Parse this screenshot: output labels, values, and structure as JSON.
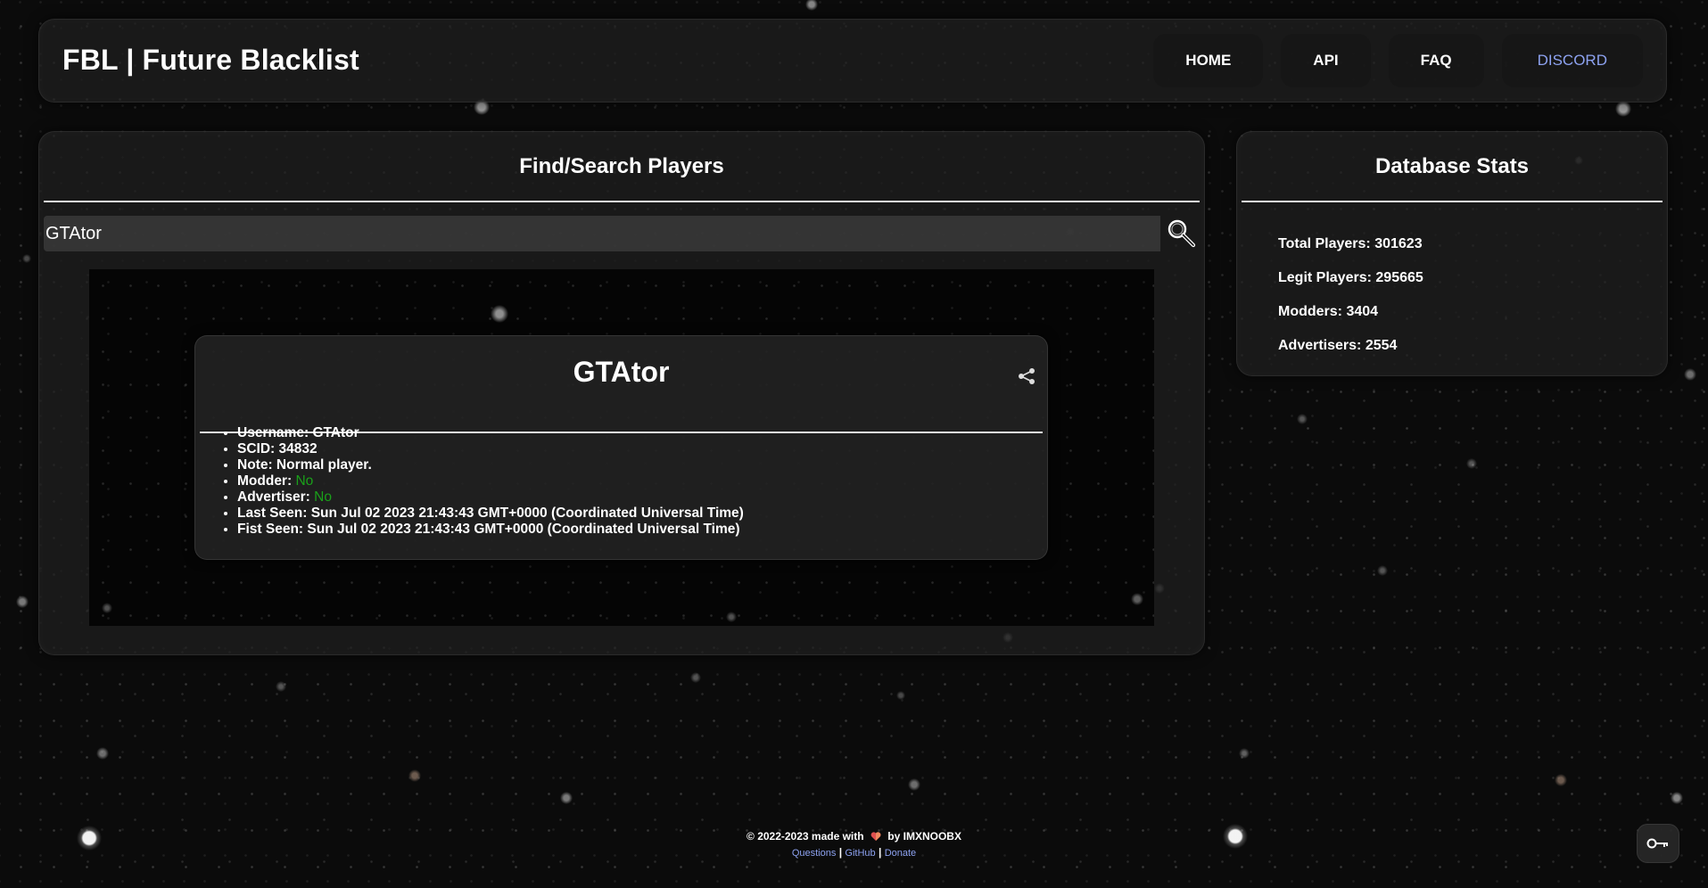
{
  "header": {
    "brand": "FBL | Future Blacklist",
    "nav": {
      "home": "HOME",
      "api": "API",
      "faq": "FAQ",
      "discord": "DISCORD"
    }
  },
  "search": {
    "title": "Find/Search Players",
    "input_value": "GTAtor"
  },
  "player": {
    "name": "GTAtor",
    "fields": {
      "username_label": "Username:",
      "username": "GTAtor",
      "scid_label": "SCID:",
      "scid": "34832",
      "note_label": "Note:",
      "note": "Normal player.",
      "modder_label": "Modder:",
      "modder": "No",
      "advertiser_label": "Advertiser:",
      "advertiser": "No",
      "last_seen_label": "Last Seen:",
      "last_seen": "Sun Jul 02 2023 21:43:43 GMT+0000 (Coordinated Universal Time)",
      "first_seen_label": "Fist Seen:",
      "first_seen": "Sun Jul 02 2023 21:43:43 GMT+0000 (Coordinated Universal Time)"
    }
  },
  "stats": {
    "title": "Database Stats",
    "total_label": "Total Players:",
    "total": "301623",
    "legit_label": "Legit Players:",
    "legit": "295665",
    "modders_label": "Modders:",
    "modders": "3404",
    "advertisers_label": "Advertisers:",
    "advertisers": "2554"
  },
  "footer": {
    "copyright_prefix": "© 2022-2023 made with",
    "by_text": "by IMXNOOBX",
    "links": {
      "questions": "Questions",
      "github": "GitHub",
      "donate": "Donate"
    },
    "separator": "|"
  },
  "icons": {
    "search": "magnifier-icon",
    "share": "share-icon",
    "heart": "heart-icon",
    "key": "key-icon"
  },
  "colors": {
    "accent_link": "#8da2f0",
    "status_no": "#1aa01a",
    "panel_bg": "#1e1e1e"
  }
}
